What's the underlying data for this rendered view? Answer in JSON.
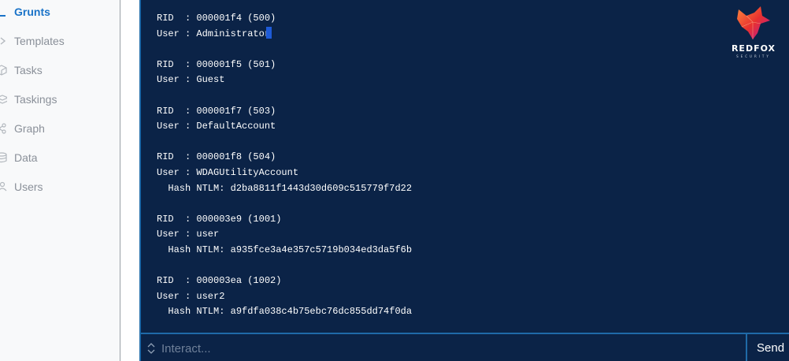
{
  "sidebar": {
    "items": [
      {
        "label": "Grunts",
        "icon": "grunts-icon",
        "active": true
      },
      {
        "label": "Templates",
        "icon": "chevron-right-icon",
        "active": false
      },
      {
        "label": "Tasks",
        "icon": "cube-icon",
        "active": false
      },
      {
        "label": "Taskings",
        "icon": "layers-icon",
        "active": false
      },
      {
        "label": "Graph",
        "icon": "share-icon",
        "active": false
      },
      {
        "label": "Data",
        "icon": "database-icon",
        "active": false
      },
      {
        "label": "Users",
        "icon": "users-icon",
        "active": false
      }
    ]
  },
  "terminal": {
    "output": "RID  : 000001f4 (500)\nUser : Administrator\n\nRID  : 000001f5 (501)\nUser : Guest\n\nRID  : 000001f7 (503)\nUser : DefaultAccount\n\nRID  : 000001f8 (504)\nUser : WDAGUtilityAccount\n  Hash NTLM: d2ba8811f1443d30d609c515779f7d22\n\nRID  : 000003e9 (1001)\nUser : user\n  Hash NTLM: a935fce3a4e357c5719b034ed3da5f6b\n\nRID  : 000003ea (1002)\nUser : user2\n  Hash NTLM: a9fdfa038c4b75ebc76dc855dd74f0da"
  },
  "logo": {
    "text": "REDFOX",
    "subtext": "SECURITY"
  },
  "input": {
    "placeholder": "Interact..."
  },
  "send_label": "Send",
  "colors": {
    "terminal_bg": "#0b2347",
    "accent": "#1a73c8",
    "border": "#1f6aa8"
  }
}
